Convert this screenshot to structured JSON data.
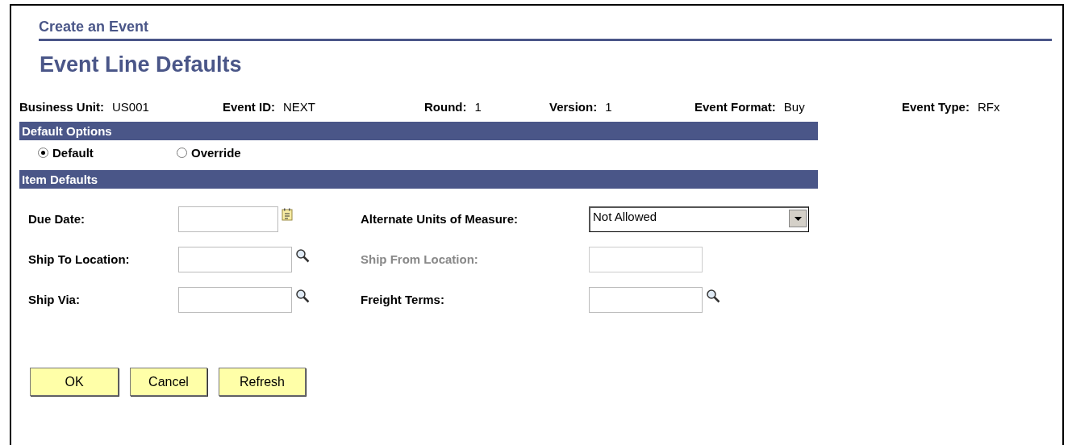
{
  "header": "Create an Event",
  "title": "Event Line Defaults",
  "info": [
    {
      "label": "Business Unit:",
      "value": "US001"
    },
    {
      "label": "Event ID:",
      "value": "NEXT"
    },
    {
      "label": "Round:",
      "value": "1"
    },
    {
      "label": "Version:",
      "value": "1"
    },
    {
      "label": "Event Format:",
      "value": "Buy"
    },
    {
      "label": "Event Type:",
      "value": "RFx"
    }
  ],
  "default_options": {
    "heading": "Default Options",
    "options": [
      {
        "label": "Default",
        "selected": true
      },
      {
        "label": "Override",
        "selected": false
      }
    ]
  },
  "item_defaults": {
    "heading": "Item Defaults",
    "fields": [
      {
        "label": "Due Date:",
        "kind": "date",
        "disabled": false
      },
      {
        "label": "Alternate Units of Measure:",
        "kind": "select",
        "value": "Not Allowed",
        "disabled": false
      },
      {
        "label": "Ship To Location:",
        "kind": "lookup",
        "disabled": false
      },
      {
        "label": "Ship From Location:",
        "kind": "text",
        "disabled": true
      },
      {
        "label": "Ship Via:",
        "kind": "lookup",
        "disabled": false
      },
      {
        "label": "Freight Terms:",
        "kind": "lookup",
        "disabled": false
      }
    ]
  },
  "buttons": [
    "OK",
    "Cancel",
    "Refresh"
  ]
}
